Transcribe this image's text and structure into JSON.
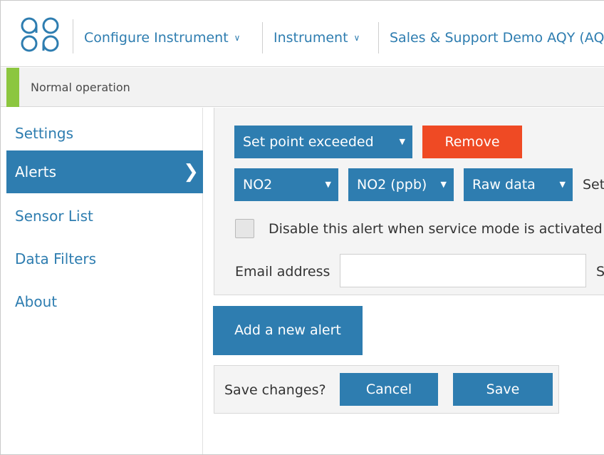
{
  "header": {
    "nav": [
      {
        "label": "Configure Instrument",
        "chevron": "∨"
      },
      {
        "label": "Instrument",
        "chevron": "∨"
      },
      {
        "label": "Sales & Support Demo AQY (AQ"
      }
    ]
  },
  "status": {
    "text": "Normal operation",
    "accent_color": "#8cc63f"
  },
  "sidebar": {
    "items": [
      {
        "label": "Settings"
      },
      {
        "label": "Alerts",
        "active": true
      },
      {
        "label": "Sensor List"
      },
      {
        "label": "Data Filters"
      },
      {
        "label": "About"
      }
    ],
    "active_arrow": "❯"
  },
  "alert": {
    "type_select": "Set point exceeded",
    "remove_label": "Remove",
    "sensor_select": "NO2",
    "unit_select": "NO2 (ppb)",
    "data_select": "Raw data",
    "set_text": "Set",
    "caret": "▼",
    "checkbox_label": "Disable this alert when service mode is activated",
    "email_label": "Email address",
    "email_value": "",
    "s_text": "S"
  },
  "add_alert_label": "Add a new alert",
  "save_bar": {
    "prompt": "Save changes?",
    "cancel_label": "Cancel",
    "save_label": "Save"
  },
  "colors": {
    "primary": "#2e7db0",
    "danger": "#ef4a24",
    "accent": "#8cc63f"
  }
}
